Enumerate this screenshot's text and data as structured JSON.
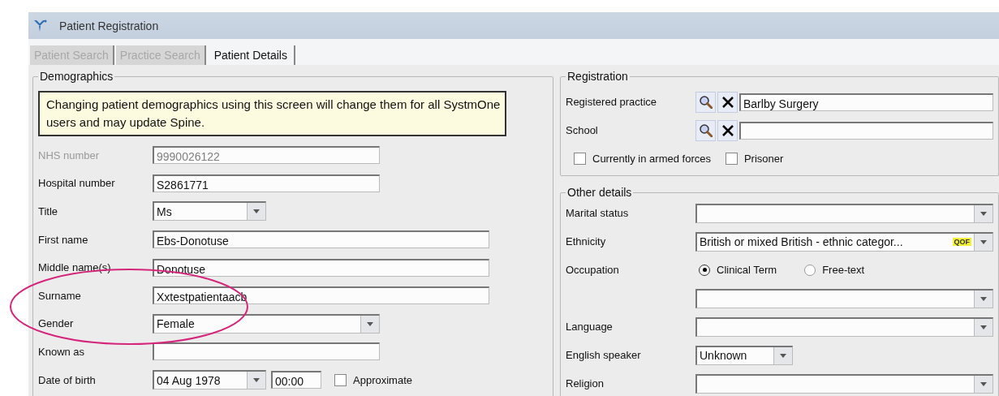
{
  "window": {
    "title": "Patient Registration"
  },
  "tabs": [
    {
      "label": "Patient Search",
      "selected": false,
      "disabled": true
    },
    {
      "label": "Practice Search",
      "selected": false,
      "disabled": true
    },
    {
      "label": "Patient Details",
      "selected": true,
      "disabled": false
    }
  ],
  "demographics": {
    "legend": "Demographics",
    "notice": "Changing patient demographics using this screen will change them for all SystmOne users and may update Spine.",
    "fields": [
      {
        "kind": "text",
        "label": "NHS number",
        "value": "9990026122",
        "disabled": true
      },
      {
        "kind": "text",
        "label": "Hospital number",
        "value": "S2861771",
        "disabled": false
      },
      {
        "kind": "small-combo",
        "label": "Title",
        "value": "Ms",
        "disabled": false
      },
      {
        "kind": "long-text",
        "label": "First name",
        "value": "Ebs-Donotuse",
        "disabled": false
      },
      {
        "kind": "long-text",
        "label": "Middle name(s)",
        "value": "Donotuse",
        "disabled": false
      },
      {
        "kind": "long-text",
        "label": "Surname",
        "value": "Xxtestpatientaacb",
        "disabled": false
      },
      {
        "kind": "combo",
        "label": "Gender",
        "value": "Female",
        "disabled": false
      },
      {
        "kind": "text",
        "label": "Known as",
        "disabled": false
      },
      {
        "kind": "date",
        "label": "Date of birth",
        "value": "04 Aug 1978",
        "time": "00:00",
        "checkbox": {
          "label": "Approximate",
          "checked": false
        },
        "disabled": false
      }
    ]
  },
  "registration": {
    "legend": "Registration",
    "lookups": [
      {
        "label": "Registered practice",
        "value": "Barlby Surgery"
      },
      {
        "label": "School"
      }
    ],
    "checkboxes": [
      {
        "label": "Currently in armed forces",
        "checked": false
      },
      {
        "label": "Prisoner",
        "checked": false
      }
    ]
  },
  "other_details": {
    "legend": "Other details",
    "rows": [
      {
        "kind": "combo",
        "label": "Marital status"
      },
      {
        "kind": "combo",
        "label": "Ethnicity",
        "value": "British or mixed British - ethnic categor...",
        "badge": "QOF"
      },
      {
        "kind": "radios",
        "label": "Occupation",
        "options": [
          {
            "label": "Clinical Term",
            "selected": true
          },
          {
            "label": "Free-text",
            "selected": false
          }
        ]
      },
      {
        "kind": "combo"
      },
      {
        "kind": "combo",
        "label": "Language"
      },
      {
        "kind": "small-combo",
        "label": "English speaker",
        "value": "Unknown"
      },
      {
        "kind": "combo",
        "label": "Religion"
      }
    ]
  }
}
